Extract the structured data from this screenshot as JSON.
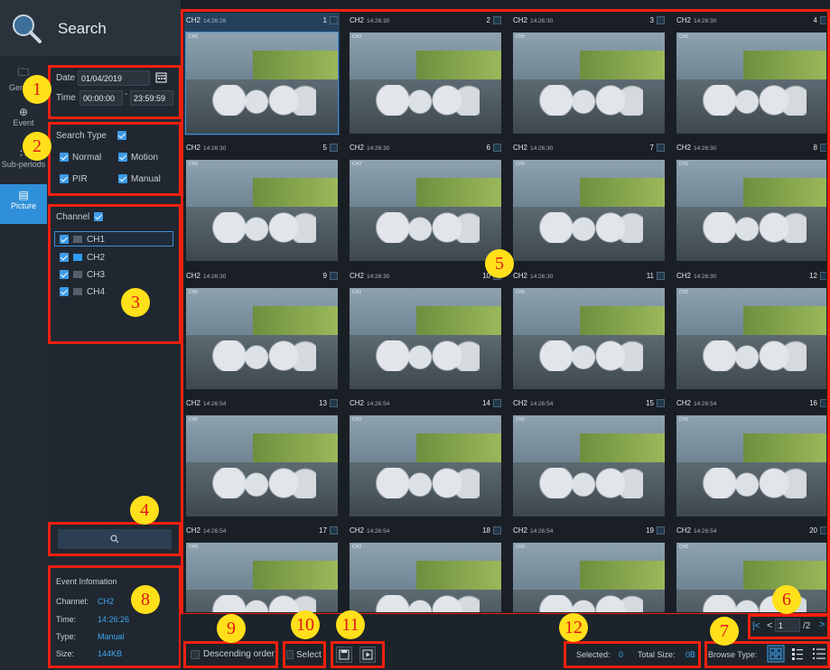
{
  "header": {
    "title": "Search"
  },
  "nav": {
    "items": [
      {
        "label": "General",
        "icon": "folder-icon"
      },
      {
        "label": "Event",
        "icon": "crosshair-icon"
      },
      {
        "label": "Sub-periods",
        "icon": "sub-periods-icon"
      },
      {
        "label": "Picture",
        "icon": "image-icon",
        "active": true
      }
    ]
  },
  "datetime": {
    "date_label": "Date",
    "date_value": "01/04/2019",
    "time_label": "Time",
    "time_start": "00:00:00",
    "time_sep": "-",
    "time_end": "23:59:59"
  },
  "search_type": {
    "label": "Search Type",
    "options": [
      {
        "label": "Normal",
        "checked": true
      },
      {
        "label": "Motion",
        "checked": true
      },
      {
        "label": "PIR",
        "checked": true
      },
      {
        "label": "Manual",
        "checked": true
      }
    ]
  },
  "channel": {
    "label": "Channel",
    "items": [
      {
        "label": "CH1",
        "checked": true,
        "active": false
      },
      {
        "label": "CH2",
        "checked": true,
        "active": true
      },
      {
        "label": "CH3",
        "checked": true,
        "active": false
      },
      {
        "label": "CH4",
        "checked": true,
        "active": false
      }
    ]
  },
  "event_info": {
    "title": "Event Infomation",
    "channel_label": "Channel:",
    "channel_value": "CH2",
    "time_label": "Time:",
    "time_value": "14:26:26",
    "type_label": "Type:",
    "type_value": "Manual",
    "size_label": "Size:",
    "size_value": "144KB"
  },
  "grid": {
    "items": [
      {
        "ch": "CH2",
        "ts": "14:26:26",
        "num": "1",
        "selected": true
      },
      {
        "ch": "CH2",
        "ts": "14:26:30",
        "num": "2"
      },
      {
        "ch": "CH2",
        "ts": "14:26:30",
        "num": "3"
      },
      {
        "ch": "CH2",
        "ts": "14:26:30",
        "num": "4"
      },
      {
        "ch": "CH2",
        "ts": "14:26:30",
        "num": "5"
      },
      {
        "ch": "CH2",
        "ts": "14:26:30",
        "num": "6"
      },
      {
        "ch": "CH2",
        "ts": "14:26:30",
        "num": "7"
      },
      {
        "ch": "CH2",
        "ts": "14:26:30",
        "num": "8"
      },
      {
        "ch": "CH2",
        "ts": "14:26:30",
        "num": "9"
      },
      {
        "ch": "CH2",
        "ts": "14:26:30",
        "num": "10"
      },
      {
        "ch": "CH2",
        "ts": "14:26:30",
        "num": "11"
      },
      {
        "ch": "CH2",
        "ts": "14:26:30",
        "num": "12"
      },
      {
        "ch": "CH2",
        "ts": "14:26:54",
        "num": "13"
      },
      {
        "ch": "CH2",
        "ts": "14:26:54",
        "num": "14"
      },
      {
        "ch": "CH2",
        "ts": "14:26:54",
        "num": "15"
      },
      {
        "ch": "CH2",
        "ts": "14:26:54",
        "num": "16"
      },
      {
        "ch": "CH2",
        "ts": "14:26:54",
        "num": "17"
      },
      {
        "ch": "CH2",
        "ts": "14:26:54",
        "num": "18"
      },
      {
        "ch": "CH2",
        "ts": "14:26:54",
        "num": "19"
      },
      {
        "ch": "CH2",
        "ts": "14:26:54",
        "num": "20"
      }
    ]
  },
  "bottom": {
    "descending_label": "Descending order",
    "select_label": "Select",
    "selected_label": "Selected:",
    "selected_value": "0",
    "total_label": "Total Size:",
    "total_value": "0B",
    "browse_label": "Browse Type:"
  },
  "pager": {
    "current": "1",
    "total": "/2"
  },
  "annotations": [
    "1",
    "2",
    "3",
    "4",
    "5",
    "6",
    "7",
    "8",
    "9",
    "10",
    "11",
    "12"
  ],
  "colors": {
    "accent": "#2f8fd8",
    "highlight": "#f0200f",
    "badge": "#ffe01a",
    "value_blue": "#3ea7f0"
  }
}
